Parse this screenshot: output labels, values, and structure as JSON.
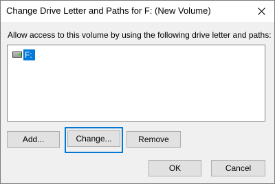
{
  "dialog": {
    "title": "Change Drive Letter and Paths for F: (New Volume)",
    "close_icon": "close-icon"
  },
  "main": {
    "prompt": "Allow access to this volume by using the following drive letter and paths:",
    "list": {
      "items": [
        {
          "icon": "drive-icon",
          "label": "F:",
          "selected": true
        }
      ]
    }
  },
  "buttons": {
    "add": "Add...",
    "change": "Change...",
    "remove": "Remove",
    "ok": "OK",
    "cancel": "Cancel"
  },
  "colors": {
    "accent": "#0078d7",
    "dialog_bg": "#f0f0f0",
    "button_bg": "#e1e1e1"
  }
}
